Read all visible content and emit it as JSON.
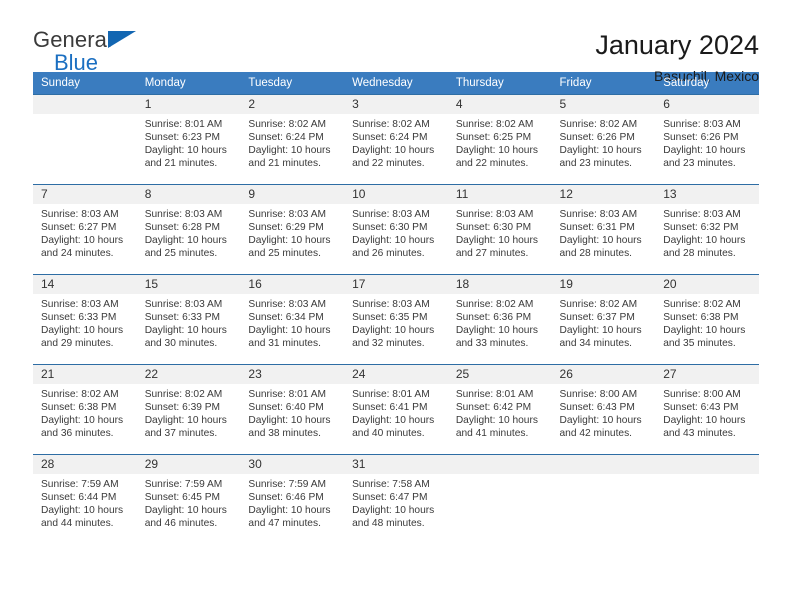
{
  "brand": {
    "line1": "General",
    "line2": "Blue",
    "triangle_color": "#1266b2",
    "blue_color": "#1b6fc1"
  },
  "header": {
    "title": "January 2024",
    "subtitle": "Basuchil, Mexico"
  },
  "theme": {
    "header_bg": "#3a7cbf",
    "row_border": "#2e6da4",
    "daynum_bg": "#f1f1f1"
  },
  "weekdays": [
    "Sunday",
    "Monday",
    "Tuesday",
    "Wednesday",
    "Thursday",
    "Friday",
    "Saturday"
  ],
  "weeks": [
    [
      {
        "day": "",
        "sunrise": "",
        "sunset": "",
        "daylight_1": "",
        "daylight_2": ""
      },
      {
        "day": "1",
        "sunrise": "Sunrise: 8:01 AM",
        "sunset": "Sunset: 6:23 PM",
        "daylight_1": "Daylight: 10 hours",
        "daylight_2": "and 21 minutes."
      },
      {
        "day": "2",
        "sunrise": "Sunrise: 8:02 AM",
        "sunset": "Sunset: 6:24 PM",
        "daylight_1": "Daylight: 10 hours",
        "daylight_2": "and 21 minutes."
      },
      {
        "day": "3",
        "sunrise": "Sunrise: 8:02 AM",
        "sunset": "Sunset: 6:24 PM",
        "daylight_1": "Daylight: 10 hours",
        "daylight_2": "and 22 minutes."
      },
      {
        "day": "4",
        "sunrise": "Sunrise: 8:02 AM",
        "sunset": "Sunset: 6:25 PM",
        "daylight_1": "Daylight: 10 hours",
        "daylight_2": "and 22 minutes."
      },
      {
        "day": "5",
        "sunrise": "Sunrise: 8:02 AM",
        "sunset": "Sunset: 6:26 PM",
        "daylight_1": "Daylight: 10 hours",
        "daylight_2": "and 23 minutes."
      },
      {
        "day": "6",
        "sunrise": "Sunrise: 8:03 AM",
        "sunset": "Sunset: 6:26 PM",
        "daylight_1": "Daylight: 10 hours",
        "daylight_2": "and 23 minutes."
      }
    ],
    [
      {
        "day": "7",
        "sunrise": "Sunrise: 8:03 AM",
        "sunset": "Sunset: 6:27 PM",
        "daylight_1": "Daylight: 10 hours",
        "daylight_2": "and 24 minutes."
      },
      {
        "day": "8",
        "sunrise": "Sunrise: 8:03 AM",
        "sunset": "Sunset: 6:28 PM",
        "daylight_1": "Daylight: 10 hours",
        "daylight_2": "and 25 minutes."
      },
      {
        "day": "9",
        "sunrise": "Sunrise: 8:03 AM",
        "sunset": "Sunset: 6:29 PM",
        "daylight_1": "Daylight: 10 hours",
        "daylight_2": "and 25 minutes."
      },
      {
        "day": "10",
        "sunrise": "Sunrise: 8:03 AM",
        "sunset": "Sunset: 6:30 PM",
        "daylight_1": "Daylight: 10 hours",
        "daylight_2": "and 26 minutes."
      },
      {
        "day": "11",
        "sunrise": "Sunrise: 8:03 AM",
        "sunset": "Sunset: 6:30 PM",
        "daylight_1": "Daylight: 10 hours",
        "daylight_2": "and 27 minutes."
      },
      {
        "day": "12",
        "sunrise": "Sunrise: 8:03 AM",
        "sunset": "Sunset: 6:31 PM",
        "daylight_1": "Daylight: 10 hours",
        "daylight_2": "and 28 minutes."
      },
      {
        "day": "13",
        "sunrise": "Sunrise: 8:03 AM",
        "sunset": "Sunset: 6:32 PM",
        "daylight_1": "Daylight: 10 hours",
        "daylight_2": "and 28 minutes."
      }
    ],
    [
      {
        "day": "14",
        "sunrise": "Sunrise: 8:03 AM",
        "sunset": "Sunset: 6:33 PM",
        "daylight_1": "Daylight: 10 hours",
        "daylight_2": "and 29 minutes."
      },
      {
        "day": "15",
        "sunrise": "Sunrise: 8:03 AM",
        "sunset": "Sunset: 6:33 PM",
        "daylight_1": "Daylight: 10 hours",
        "daylight_2": "and 30 minutes."
      },
      {
        "day": "16",
        "sunrise": "Sunrise: 8:03 AM",
        "sunset": "Sunset: 6:34 PM",
        "daylight_1": "Daylight: 10 hours",
        "daylight_2": "and 31 minutes."
      },
      {
        "day": "17",
        "sunrise": "Sunrise: 8:03 AM",
        "sunset": "Sunset: 6:35 PM",
        "daylight_1": "Daylight: 10 hours",
        "daylight_2": "and 32 minutes."
      },
      {
        "day": "18",
        "sunrise": "Sunrise: 8:02 AM",
        "sunset": "Sunset: 6:36 PM",
        "daylight_1": "Daylight: 10 hours",
        "daylight_2": "and 33 minutes."
      },
      {
        "day": "19",
        "sunrise": "Sunrise: 8:02 AM",
        "sunset": "Sunset: 6:37 PM",
        "daylight_1": "Daylight: 10 hours",
        "daylight_2": "and 34 minutes."
      },
      {
        "day": "20",
        "sunrise": "Sunrise: 8:02 AM",
        "sunset": "Sunset: 6:38 PM",
        "daylight_1": "Daylight: 10 hours",
        "daylight_2": "and 35 minutes."
      }
    ],
    [
      {
        "day": "21",
        "sunrise": "Sunrise: 8:02 AM",
        "sunset": "Sunset: 6:38 PM",
        "daylight_1": "Daylight: 10 hours",
        "daylight_2": "and 36 minutes."
      },
      {
        "day": "22",
        "sunrise": "Sunrise: 8:02 AM",
        "sunset": "Sunset: 6:39 PM",
        "daylight_1": "Daylight: 10 hours",
        "daylight_2": "and 37 minutes."
      },
      {
        "day": "23",
        "sunrise": "Sunrise: 8:01 AM",
        "sunset": "Sunset: 6:40 PM",
        "daylight_1": "Daylight: 10 hours",
        "daylight_2": "and 38 minutes."
      },
      {
        "day": "24",
        "sunrise": "Sunrise: 8:01 AM",
        "sunset": "Sunset: 6:41 PM",
        "daylight_1": "Daylight: 10 hours",
        "daylight_2": "and 40 minutes."
      },
      {
        "day": "25",
        "sunrise": "Sunrise: 8:01 AM",
        "sunset": "Sunset: 6:42 PM",
        "daylight_1": "Daylight: 10 hours",
        "daylight_2": "and 41 minutes."
      },
      {
        "day": "26",
        "sunrise": "Sunrise: 8:00 AM",
        "sunset": "Sunset: 6:43 PM",
        "daylight_1": "Daylight: 10 hours",
        "daylight_2": "and 42 minutes."
      },
      {
        "day": "27",
        "sunrise": "Sunrise: 8:00 AM",
        "sunset": "Sunset: 6:43 PM",
        "daylight_1": "Daylight: 10 hours",
        "daylight_2": "and 43 minutes."
      }
    ],
    [
      {
        "day": "28",
        "sunrise": "Sunrise: 7:59 AM",
        "sunset": "Sunset: 6:44 PM",
        "daylight_1": "Daylight: 10 hours",
        "daylight_2": "and 44 minutes."
      },
      {
        "day": "29",
        "sunrise": "Sunrise: 7:59 AM",
        "sunset": "Sunset: 6:45 PM",
        "daylight_1": "Daylight: 10 hours",
        "daylight_2": "and 46 minutes."
      },
      {
        "day": "30",
        "sunrise": "Sunrise: 7:59 AM",
        "sunset": "Sunset: 6:46 PM",
        "daylight_1": "Daylight: 10 hours",
        "daylight_2": "and 47 minutes."
      },
      {
        "day": "31",
        "sunrise": "Sunrise: 7:58 AM",
        "sunset": "Sunset: 6:47 PM",
        "daylight_1": "Daylight: 10 hours",
        "daylight_2": "and 48 minutes."
      },
      {
        "day": "",
        "sunrise": "",
        "sunset": "",
        "daylight_1": "",
        "daylight_2": ""
      },
      {
        "day": "",
        "sunrise": "",
        "sunset": "",
        "daylight_1": "",
        "daylight_2": ""
      },
      {
        "day": "",
        "sunrise": "",
        "sunset": "",
        "daylight_1": "",
        "daylight_2": ""
      }
    ]
  ]
}
